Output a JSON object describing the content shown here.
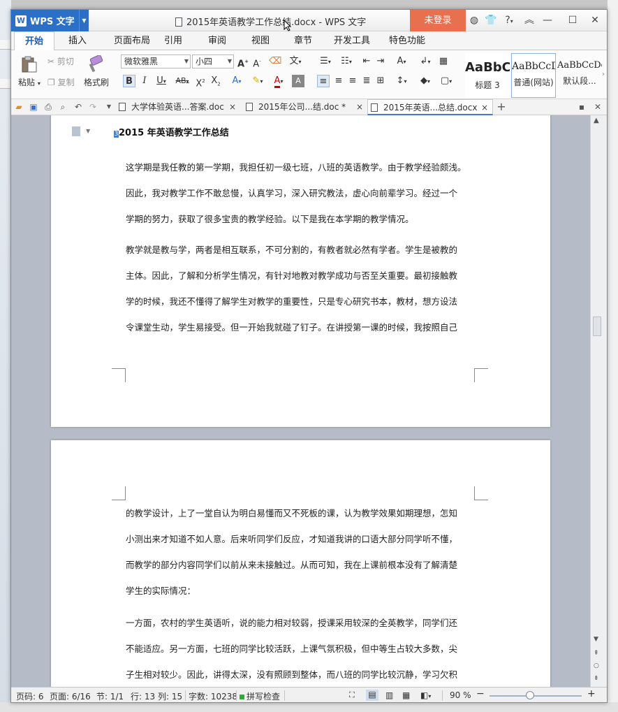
{
  "window": {
    "app_name": "WPS 文字",
    "title": "2015年英语教学工作总结.docx - WPS 文字",
    "login_label": "未登录"
  },
  "menu": [
    "开始",
    "插入",
    "页面布局",
    "引用",
    "审阅",
    "视图",
    "章节",
    "开发工具",
    "特色功能"
  ],
  "ribbon": {
    "paste": "粘贴",
    "cut": "剪切",
    "copy": "复制",
    "format_painter": "格式刷",
    "font_name": "微软雅黑",
    "font_size": "小四",
    "styles": [
      {
        "preview": "AaBbC",
        "name": "标题 3"
      },
      {
        "preview": "AaBbCcD",
        "name": "普通(网站)"
      },
      {
        "preview": "AaBbCcDd",
        "name": "默认段..."
      }
    ]
  },
  "doc_tabs": [
    {
      "label": "大学体验英语...答案.doc",
      "close": "×"
    },
    {
      "label": "2015年公司...结.doc *",
      "close": "×"
    },
    {
      "label": "2015年英语...总结.docx",
      "close": "×"
    }
  ],
  "document": {
    "title": "2015 年英语教学工作总结",
    "cursor_mark": "3",
    "page1_lines": [
      "这学期是我任教的第一学期，我担任初一级七班，八班的英语教学。由于教学经验颇浅。",
      "因此，我对教学工作不敢怠慢，认真学习，深入研究教法，虚心向前辈学习。经过一个",
      "学期的努力，获取了很多宝贵的教学经验。以下是我在本学期的教学情况。",
      "教学就是教与学，两者是相互联系，不可分割的，有教者就必然有学者。学生是被教的",
      "主体。因此，了解和分析学生情况，有针对地教对教学成功与否至关重要。最初接触教",
      "学的时候，我还不懂得了解学生对教学的重要性，只是专心研究书本，教材，想方设法",
      "令课堂生动，学生易接受。但一开始我就碰了钉子。在讲授第一课的时候，我按照自己"
    ],
    "page2_lines": [
      "的教学设计，上了一堂自认为明白易懂而又不死板的课，认为教学效果如期理想，怎知",
      "小测出来才知道不如人意。后来听同学们反应，才知道我讲的口语大部分同学听不懂，",
      "而教学的部分内容同学们以前从来未接触过。从而可知，我在上课前根本没有了解清楚",
      "学生的实际情况：",
      "一方面，农村的学生英语听，说的能力相对较弱，授课采用较深的全英教学，同学们还",
      "不能适应。另一方面，七班的同学比较活跃，上课气氛积极，但中等生占较大多数，尖",
      "子生相对较少。因此，讲得太深，没有照顾到整体，而八班的同学比较沉静，学习欠积"
    ]
  },
  "status": {
    "page_num": "页码: 6",
    "pages": "页面: 6/16",
    "section": "节: 1/1",
    "row": "行: 13",
    "col": "列: 15",
    "words": "字数: 10238",
    "spell": "拼写检查",
    "zoom": "90 %",
    "zoom_minus": "−",
    "zoom_plus": "+"
  }
}
